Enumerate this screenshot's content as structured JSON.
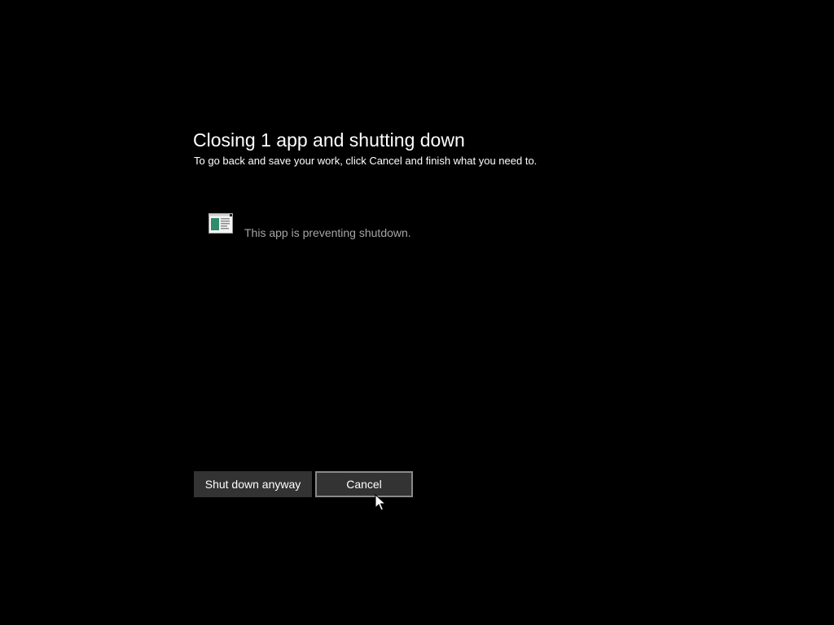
{
  "dialog": {
    "title": "Closing 1 app and shutting down",
    "subtitle": "To go back and save your work, click Cancel and finish what you need to."
  },
  "apps": [
    {
      "icon": "app-window-icon",
      "message": "This app is preventing shutdown."
    }
  ],
  "buttons": {
    "shutdown_anyway": "Shut down anyway",
    "cancel": "Cancel"
  },
  "colors": {
    "background": "#000000",
    "text_primary": "#ffffff",
    "text_secondary": "#a6a6a6",
    "button_fill": "#333333",
    "focus_border": "#8a8a8a",
    "icon_green": "#2e8b6e"
  }
}
